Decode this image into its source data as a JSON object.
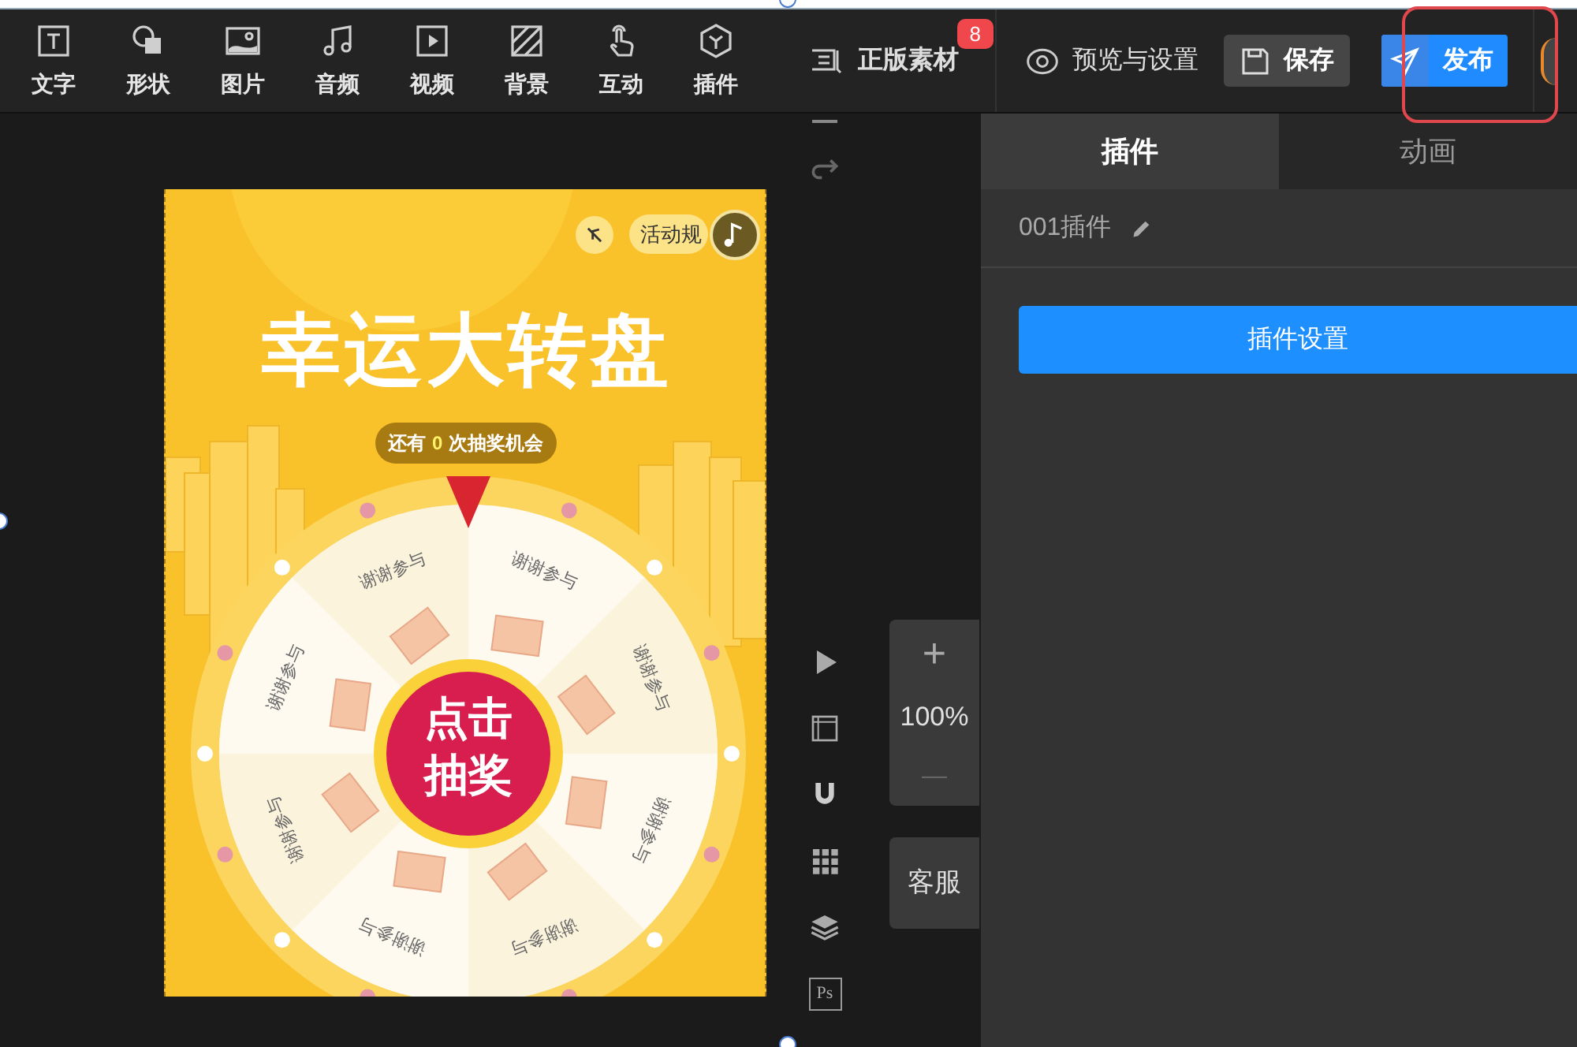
{
  "toolbar": [
    {
      "label": "文字",
      "kind": "text"
    },
    {
      "label": "形状",
      "kind": "shape"
    },
    {
      "label": "图片",
      "kind": "image"
    },
    {
      "label": "音频",
      "kind": "audio"
    },
    {
      "label": "视频",
      "kind": "video"
    },
    {
      "label": "背景",
      "kind": "background"
    },
    {
      "label": "互动",
      "kind": "interact"
    },
    {
      "label": "插件",
      "kind": "plugin"
    }
  ],
  "assets": {
    "label": "正版素材",
    "badge": "8"
  },
  "preview": {
    "label": "预览与设置"
  },
  "save": {
    "label": "保存"
  },
  "publish": {
    "label": "发布"
  },
  "design": {
    "title": "幸运大转盘",
    "rules": "活动规",
    "chances_prefix": "还有",
    "chances_count": "0",
    "chances_suffix": "次抽奖机会",
    "spin_button": "点击抽奖",
    "segments": [
      "谢谢参与",
      "谢谢参与",
      "谢谢参与",
      "谢谢参与",
      "谢谢参与",
      "谢谢参与",
      "谢谢参与",
      "谢谢参与"
    ]
  },
  "side_tools": [
    {
      "kind": "play"
    },
    {
      "kind": "ruler"
    },
    {
      "kind": "magnet"
    },
    {
      "kind": "grid"
    },
    {
      "kind": "layers"
    },
    {
      "kind": "ps",
      "label": "Ps"
    }
  ],
  "zoom": {
    "plus": "+",
    "value": "100%",
    "minus": "—"
  },
  "support": {
    "label": "客服"
  },
  "panel": {
    "tabs": [
      {
        "label": "插件",
        "selected": true
      },
      {
        "label": "动画",
        "selected": false
      }
    ],
    "name": "001插件",
    "button": "插件设置"
  }
}
